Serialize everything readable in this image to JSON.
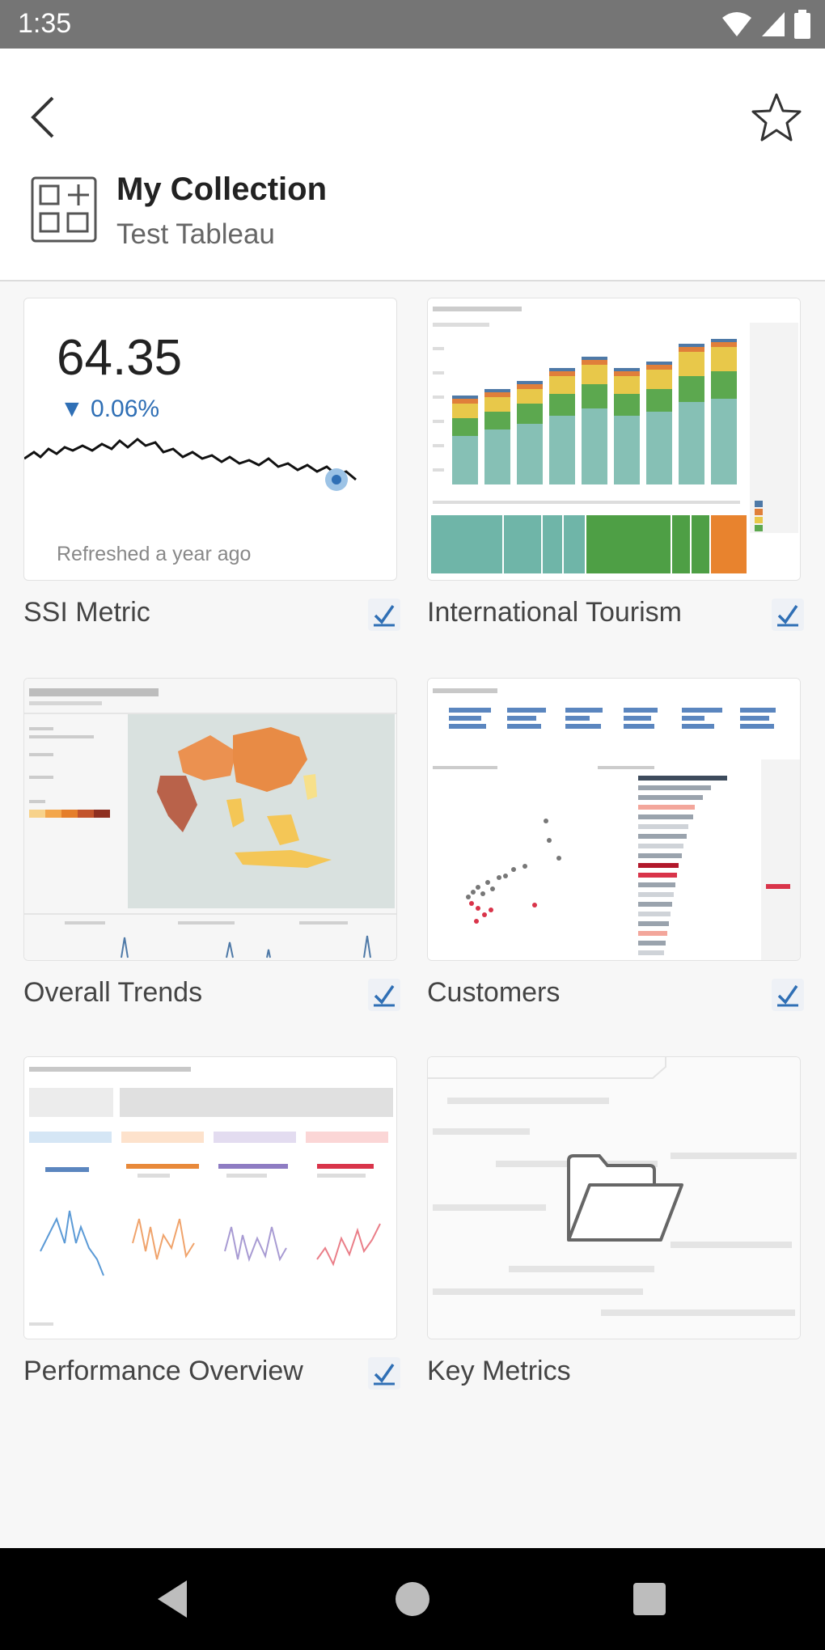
{
  "status_bar": {
    "time": "1:35"
  },
  "header": {
    "title": "My Collection",
    "subtitle": "Test Tableau"
  },
  "metric_card": {
    "value": "64.35",
    "change": "▼ 0.06%",
    "refreshed": "Refreshed a year ago"
  },
  "items": [
    {
      "label": "SSI Metric",
      "checked": true
    },
    {
      "label": "International Tourism",
      "checked": true
    },
    {
      "label": "Overall Trends",
      "checked": true
    },
    {
      "label": "Customers",
      "checked": true
    },
    {
      "label": "Performance Overview",
      "checked": true
    },
    {
      "label": "Key Metrics",
      "checked": false
    }
  ],
  "colors": {
    "accent": "#2f6fb5",
    "status_bar": "#757575",
    "nav_bar": "#000000"
  }
}
